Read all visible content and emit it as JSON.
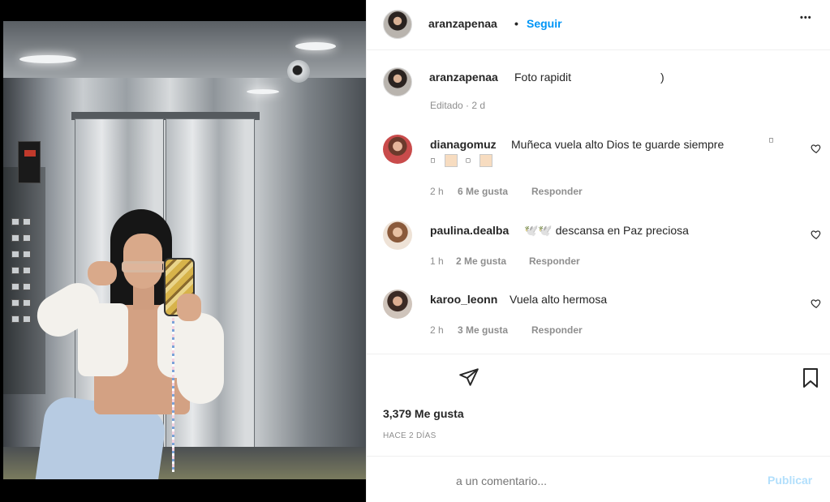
{
  "post": {
    "owner": "aranzapenaa",
    "follow_label": "Seguir",
    "separator": "•",
    "more_label": "•••",
    "caption_text": "Foto rapidit",
    "caption_tail": ")",
    "caption_meta": "Editado · 2 d"
  },
  "comments": [
    {
      "username": "dianagomuz",
      "text": "Muñeca vuela alto Dios te guarde siempre",
      "time": "2 h",
      "likes": "6 Me gusta",
      "reply": "Responder"
    },
    {
      "username": "paulina.dealba",
      "text": "🕊️🕊️  descansa en Paz preciosa",
      "time": "1 h",
      "likes": "2 Me gusta",
      "reply": "Responder"
    },
    {
      "username": "karoo_leonn",
      "text": "Vuela alto hermosa",
      "time": "2 h",
      "likes": "3 Me gusta",
      "reply": "Responder"
    }
  ],
  "footer": {
    "likes_count": "3,379 Me gusta",
    "date": "HACE 2 DÍAS",
    "comment_placeholder": "a un comentario...",
    "publish_label": "Publicar"
  },
  "icons": {
    "share": "paper-plane-icon",
    "save": "bookmark-icon",
    "like": "heart-outline-icon"
  },
  "colors": {
    "link_blue": "#0095f6",
    "publish_disabled": "#b2dffc",
    "muted": "#8e8e8e",
    "text": "#262626"
  }
}
